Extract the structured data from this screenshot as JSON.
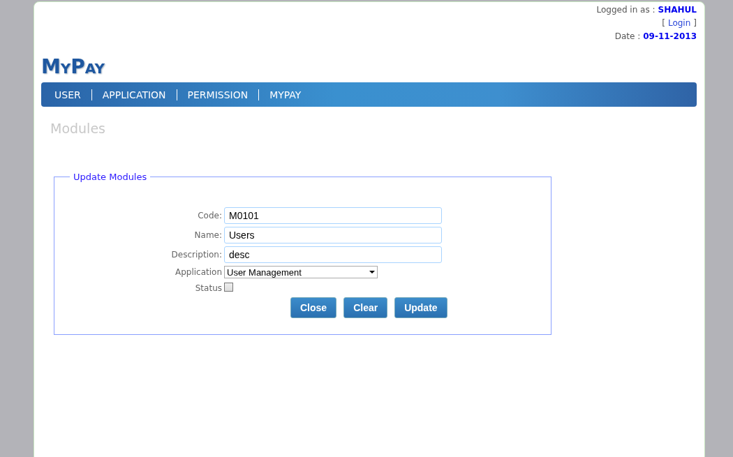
{
  "header": {
    "logged_in_label": "Logged in as :",
    "user": "SHAHUL",
    "login_open": "[",
    "login_link": "Login",
    "login_close": "]",
    "date_label": "Date :",
    "date": "09-11-2013"
  },
  "logo": "MyPay",
  "nav": [
    {
      "label": "USER"
    },
    {
      "label": "APPLICATION"
    },
    {
      "label": "PERMISSION"
    },
    {
      "label": "MYPAY"
    }
  ],
  "page_title": "Modules",
  "form": {
    "legend": "Update Modules",
    "fields": [
      {
        "kind": "text",
        "label": "Code:",
        "value": "M0101"
      },
      {
        "kind": "text",
        "label": "Name:",
        "value": "Users"
      },
      {
        "kind": "text",
        "label": "Description:",
        "value": "desc"
      },
      {
        "kind": "select",
        "label": "Application",
        "value": "User Management"
      },
      {
        "kind": "checkbox",
        "label": "Status",
        "checked": false
      }
    ],
    "buttons": [
      "Close",
      "Clear",
      "Update"
    ]
  }
}
